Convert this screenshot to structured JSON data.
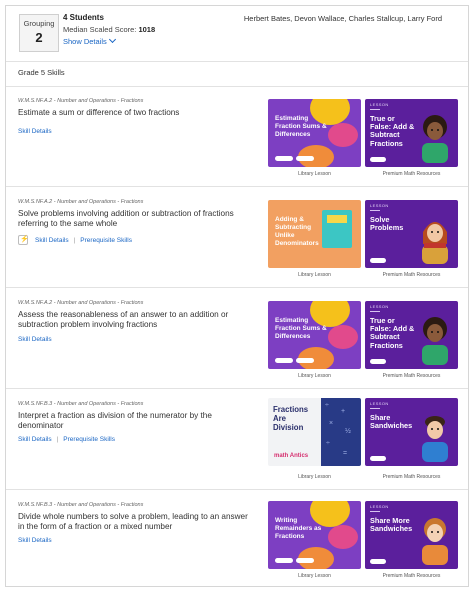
{
  "header": {
    "grouping_label": "Grouping",
    "grouping_number": "2",
    "students": "4 Students",
    "median_label": "Median Scaled Score:",
    "median_value": "1018",
    "show_details": "Show Details",
    "names": "Herbert Bates, Devon Wallace, Charles Stallcup, Larry Ford"
  },
  "grade": "Grade 5 Skills",
  "card_common": {
    "library_caption": "Library Lesson",
    "resources_caption": "Premium Math Resources",
    "lesson_tag": "LESSON"
  },
  "skills": [
    {
      "code": "W.M.S.NF.A.2 - Number and Operations - Fractions",
      "title": "Estimate a sum or difference of two fractions",
      "skill_details": "Skill Details",
      "library_title": "Estimating Fraction Sums & Differences",
      "resource_title": "True or False: Add & Subtract Fractions"
    },
    {
      "code": "W.M.S.NF.A.2 - Number and Operations - Fractions",
      "title": "Solve problems involving addition or subtraction of fractions referring to the same whole",
      "skill_details": "Skill Details",
      "prerequisite": "Prerequisite Skills",
      "library_title": "Adding & Subtracting Unlike Denominators",
      "resource_title": "Solve Problems"
    },
    {
      "code": "W.M.S.NF.A.2 - Number and Operations - Fractions",
      "title": "Assess the reasonableness of an answer to an addition or subtraction problem involving fractions",
      "skill_details": "Skill Details",
      "library_title": "Estimating Fraction Sums & Differences",
      "resource_title": "True or False: Add & Subtract Fractions"
    },
    {
      "code": "W.M.S.NF.B.3 - Number and Operations - Fractions",
      "title": "Interpret a fraction as division of the numerator by the denominator",
      "skill_details": "Skill Details",
      "prerequisite": "Prerequisite Skills",
      "library_title": "Fractions Are Division",
      "library_logo": "math Antics",
      "resource_title": "Share Sandwiches"
    },
    {
      "code": "W.M.S.NF.B.3 - Number and Operations - Fractions",
      "title": "Divide whole numbers to solve a problem, leading to an answer in the form of a fraction or a mixed number",
      "skill_details": "Skill Details",
      "library_title": "Writing Remainders as Fractions",
      "resource_title": "Share More Sandwiches"
    }
  ],
  "colors": {
    "link": "#1a66c4",
    "library_purple": "#7d3fc2",
    "resource_purple": "#5b1f9c",
    "accent_yellow": "#f5c11b"
  },
  "icons": {
    "bolt": "lightning-icon",
    "chevron": "chevron-down-icon"
  }
}
